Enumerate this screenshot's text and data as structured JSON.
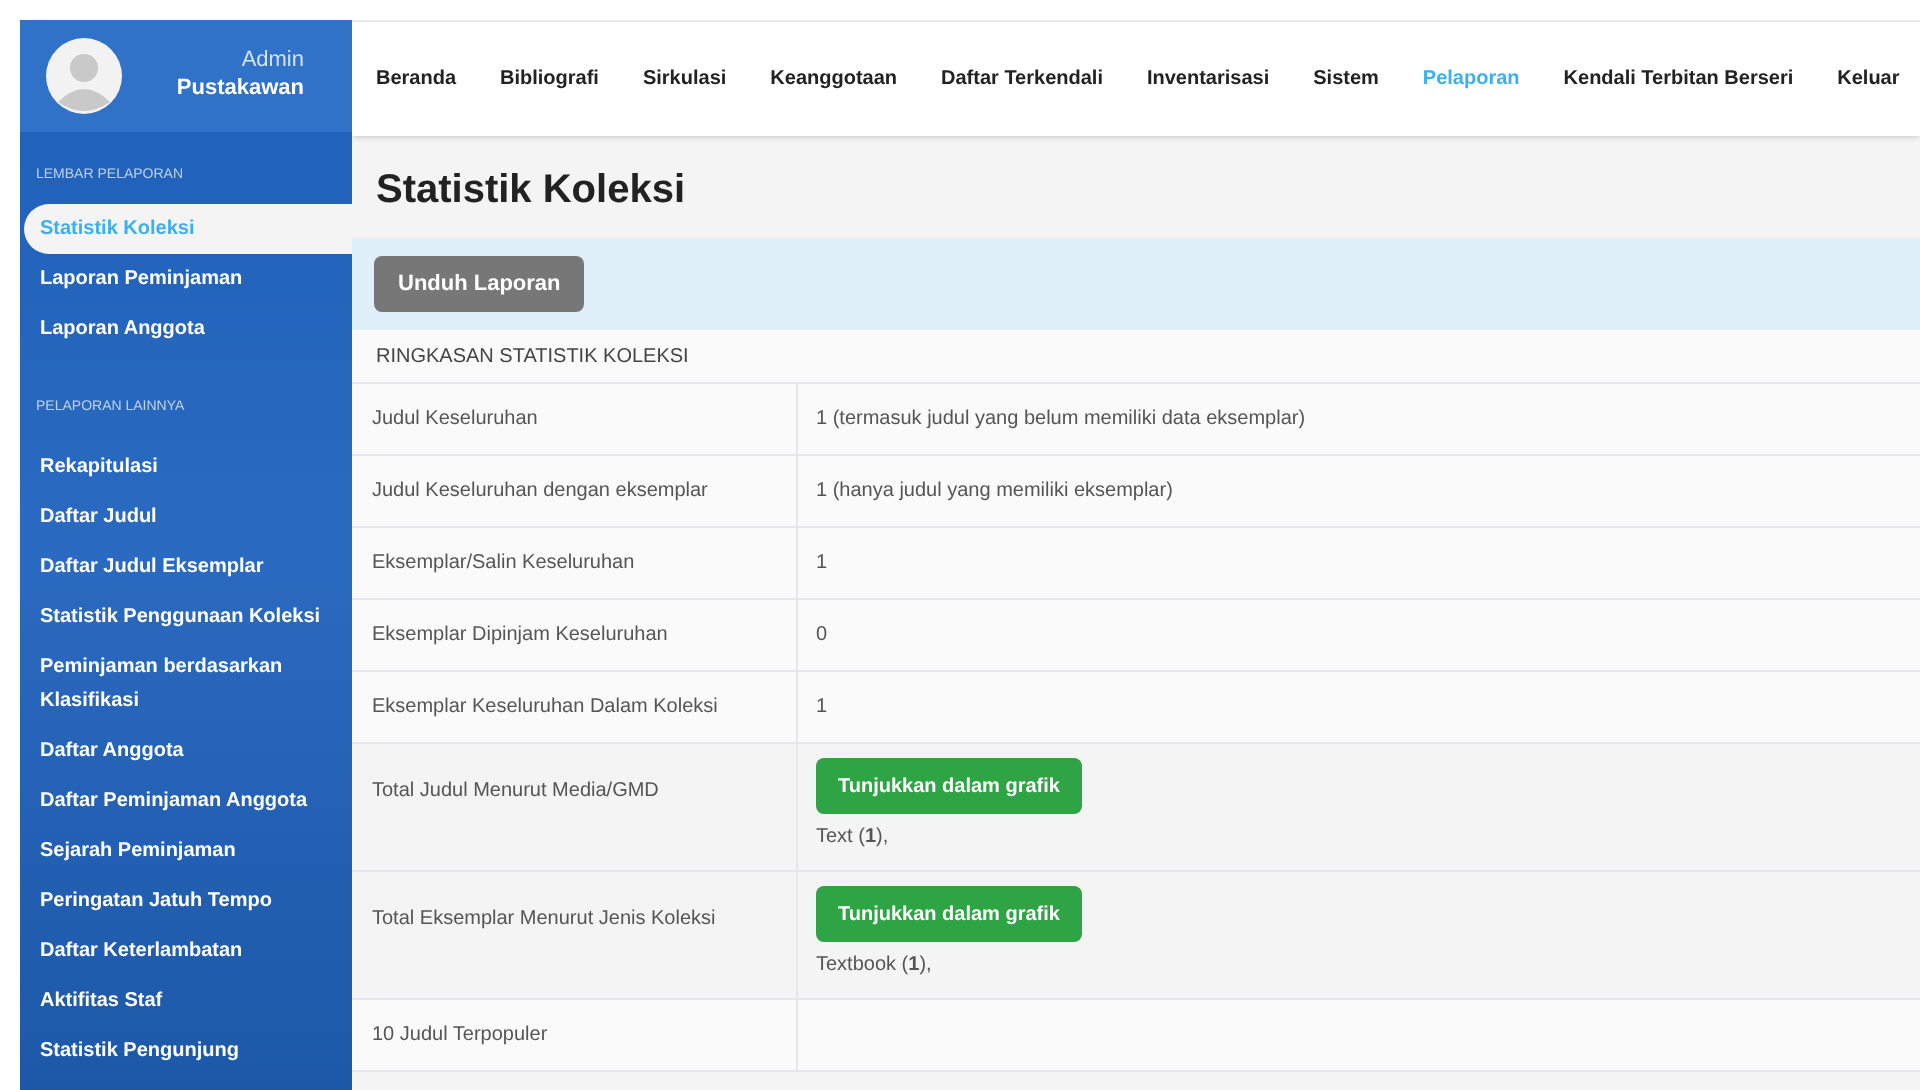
{
  "user": {
    "role": "Admin",
    "name": "Pustakawan"
  },
  "nav": [
    {
      "label": "Beranda",
      "selected": false
    },
    {
      "label": "Bibliografi",
      "selected": false
    },
    {
      "label": "Sirkulasi",
      "selected": false
    },
    {
      "label": "Keanggotaan",
      "selected": false
    },
    {
      "label": "Daftar Terkendali",
      "selected": false
    },
    {
      "label": "Inventarisasi",
      "selected": false
    },
    {
      "label": "Sistem",
      "selected": false
    },
    {
      "label": "Pelaporan",
      "selected": true
    },
    {
      "label": "Kendali Terbitan Berseri",
      "selected": false
    },
    {
      "label": "Keluar",
      "selected": false
    }
  ],
  "sidebar": {
    "sections": [
      {
        "heading": "LEMBAR PELAPORAN",
        "items": [
          {
            "label": "Statistik Koleksi",
            "selected": true
          },
          {
            "label": "Laporan Peminjaman",
            "selected": false
          },
          {
            "label": "Laporan Anggota",
            "selected": false
          }
        ]
      },
      {
        "heading": "PELAPORAN LAINNYA",
        "items": [
          {
            "label": "Rekapitulasi",
            "selected": false
          },
          {
            "label": "Daftar Judul",
            "selected": false
          },
          {
            "label": "Daftar Judul Eksemplar",
            "selected": false
          },
          {
            "label": "Statistik Penggunaan Koleksi",
            "selected": false
          },
          {
            "label": "Peminjaman berdasarkan Klasifikasi",
            "selected": false
          },
          {
            "label": "Daftar Anggota",
            "selected": false
          },
          {
            "label": "Daftar Peminjaman Anggota",
            "selected": false
          },
          {
            "label": "Sejarah Peminjaman",
            "selected": false
          },
          {
            "label": "Peringatan Jatuh Tempo",
            "selected": false
          },
          {
            "label": "Daftar Keterlambatan",
            "selected": false
          },
          {
            "label": "Aktifitas Staf",
            "selected": false
          },
          {
            "label": "Statistik Pengunjung",
            "selected": false
          }
        ]
      }
    ]
  },
  "page_title": "Statistik Koleksi",
  "download_button": "Unduh Laporan",
  "table": {
    "heading": "RINGKASAN STATISTIK KOLEKSI",
    "rows": [
      {
        "kind": "text",
        "label": "Judul Keseluruhan",
        "value": "1 (termasuk judul yang belum memiliki data eksemplar)"
      },
      {
        "kind": "text",
        "label": "Judul Keseluruhan dengan eksemplar",
        "value": "1 (hanya judul yang memiliki eksemplar)"
      },
      {
        "kind": "text",
        "label": "Eksemplar/Salin Keseluruhan",
        "value": "1"
      },
      {
        "kind": "text",
        "label": "Eksemplar Dipinjam Keseluruhan",
        "value": "0"
      },
      {
        "kind": "text",
        "label": "Eksemplar Keseluruhan Dalam Koleksi",
        "value": "1"
      },
      {
        "kind": "chart",
        "label": "Total Judul Menurut Media/GMD",
        "button": "Tunjukkan dalam grafik",
        "value": "Text (**1**),"
      },
      {
        "kind": "chart",
        "label": "Total Eksemplar Menurut Jenis Koleksi",
        "button": "Tunjukkan dalam grafik",
        "value": "Textbook (**1**),"
      },
      {
        "kind": "empty",
        "label": "10 Judul Terpopuler"
      }
    ]
  }
}
